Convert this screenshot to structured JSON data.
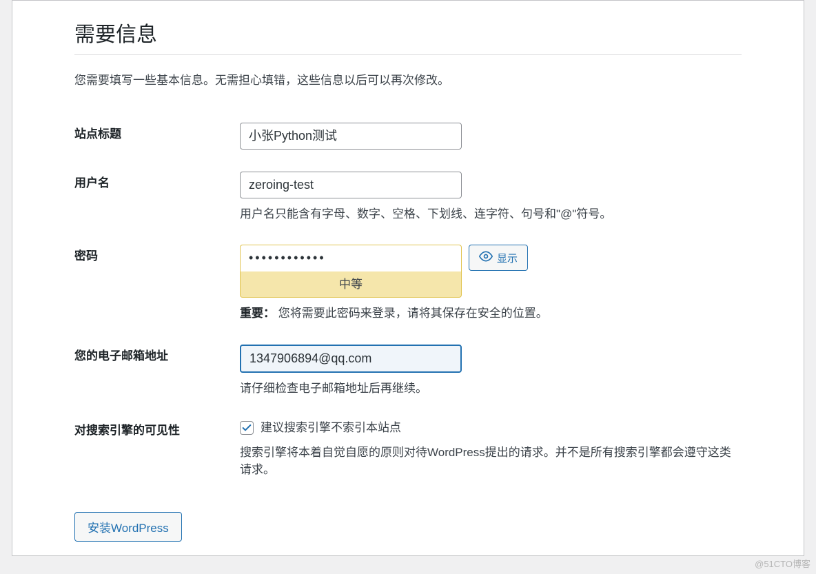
{
  "heading": "需要信息",
  "intro": "您需要填写一些基本信息。无需担心填错，这些信息以后可以再次修改。",
  "labels": {
    "site_title": "站点标题",
    "username": "用户名",
    "password": "密码",
    "email": "您的电子邮箱地址",
    "search_visibility": "对搜索引擎的可见性"
  },
  "values": {
    "site_title": "小张Python测试",
    "username": "zeroing-test",
    "password_masked": "••••••••••••",
    "email": "1347906894@qq.com"
  },
  "descriptions": {
    "username_hint": "用户名只能含有字母、数字、空格、下划线、连字符、句号和\"@\"符号。",
    "password_strength": "中等",
    "password_important_label": "重要：",
    "password_important_text": "您将需要此密码来登录，请将其保存在安全的位置。",
    "email_hint": "请仔细检查电子邮箱地址后再继续。",
    "search_checkbox_label": "建议搜索引擎不索引本站点",
    "search_hint": "搜索引擎将本着自觉自愿的原则对待WordPress提出的请求。并不是所有搜索引擎都会遵守这类请求。"
  },
  "buttons": {
    "show_password": "显示",
    "install": "安装WordPress"
  },
  "watermark": "@51CTO博客"
}
